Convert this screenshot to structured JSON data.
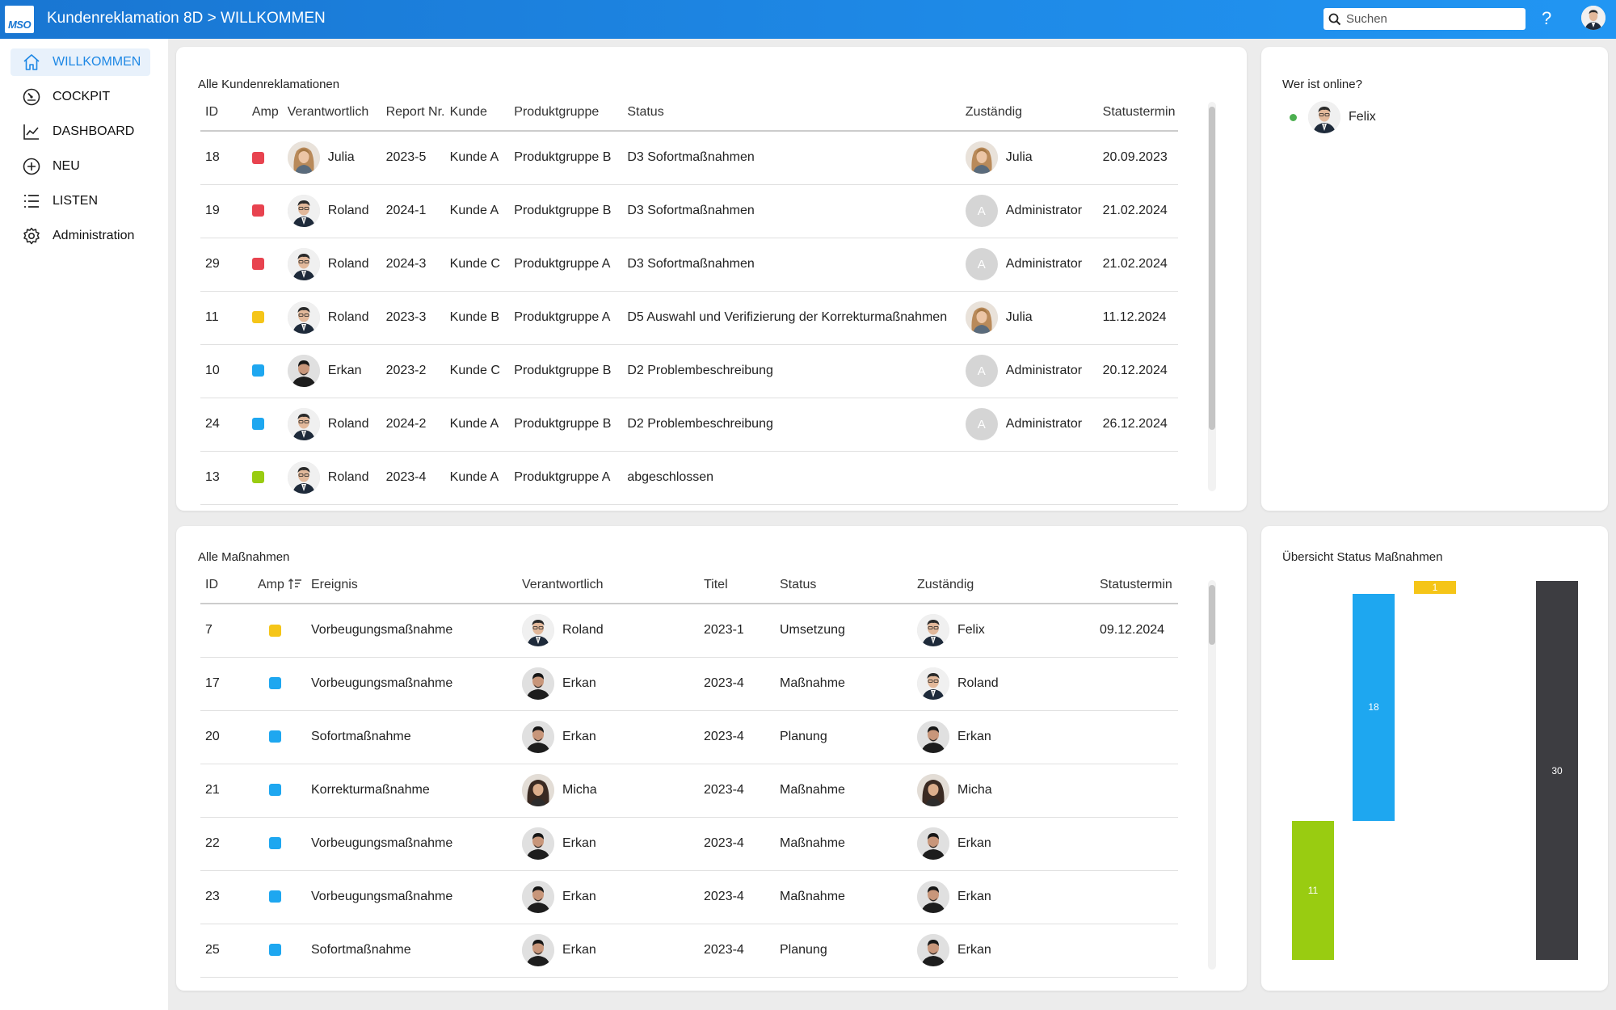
{
  "app": {
    "logo_text": "MSO",
    "title": "Kundenreklamation 8D > WILLKOMMEN",
    "search_placeholder": "Suchen",
    "help": "?"
  },
  "sidebar": {
    "items": [
      {
        "label": "WILLKOMMEN",
        "icon": "home-icon",
        "active": true
      },
      {
        "label": "COCKPIT",
        "icon": "gauge-icon"
      },
      {
        "label": "DASHBOARD",
        "icon": "line-chart-icon"
      },
      {
        "label": "NEU",
        "icon": "plus-circle-icon"
      },
      {
        "label": "LISTEN",
        "icon": "list-icon"
      },
      {
        "label": "Administration",
        "icon": "gear-icon"
      }
    ]
  },
  "complaints": {
    "title": "Alle Kundenreklamationen",
    "headers": [
      "ID",
      "Amp",
      "Verantwortlich",
      "Report Nr.",
      "Kunde",
      "Produktgruppe",
      "Status",
      "Zuständig",
      "Statustermin"
    ],
    "rows": [
      {
        "id": "18",
        "amp": "#e8434f",
        "resp": "Julia",
        "resp_avatar": "woman",
        "report": "2023-5",
        "kunde": "Kunde A",
        "gruppe": "Produktgruppe B",
        "status": "D3 Sofortmaßnahmen",
        "zust": "Julia",
        "zust_avatar": "woman",
        "termin": "20.09.2023"
      },
      {
        "id": "19",
        "amp": "#e8434f",
        "resp": "Roland",
        "resp_avatar": "man-suit",
        "report": "2024-1",
        "kunde": "Kunde A",
        "gruppe": "Produktgruppe B",
        "status": "D3 Sofortmaßnahmen",
        "zust": "Administrator",
        "zust_avatar": "admin",
        "termin": "21.02.2024"
      },
      {
        "id": "29",
        "amp": "#e8434f",
        "resp": "Roland",
        "resp_avatar": "man-suit",
        "report": "2024-3",
        "kunde": "Kunde C",
        "gruppe": "Produktgruppe A",
        "status": "D3 Sofortmaßnahmen",
        "zust": "Administrator",
        "zust_avatar": "admin",
        "termin": "21.02.2024"
      },
      {
        "id": "11",
        "amp": "#f5c518",
        "resp": "Roland",
        "resp_avatar": "man-suit",
        "report": "2023-3",
        "kunde": "Kunde B",
        "gruppe": "Produktgruppe A",
        "status": "D5 Auswahl und Verifizierung der Korrekturmaßnahmen",
        "zust": "Julia",
        "zust_avatar": "woman",
        "termin": "11.12.2024"
      },
      {
        "id": "10",
        "amp": "#1ea7f0",
        "resp": "Erkan",
        "resp_avatar": "man-dark",
        "report": "2023-2",
        "kunde": "Kunde C",
        "gruppe": "Produktgruppe B",
        "status": "D2 Problembeschreibung",
        "zust": "Administrator",
        "zust_avatar": "admin",
        "termin": "20.12.2024"
      },
      {
        "id": "24",
        "amp": "#1ea7f0",
        "resp": "Roland",
        "resp_avatar": "man-suit",
        "report": "2024-2",
        "kunde": "Kunde A",
        "gruppe": "Produktgruppe B",
        "status": "D2 Problembeschreibung",
        "zust": "Administrator",
        "zust_avatar": "admin",
        "termin": "26.12.2024"
      },
      {
        "id": "13",
        "amp": "#99cc11",
        "resp": "Roland",
        "resp_avatar": "man-suit",
        "report": "2023-4",
        "kunde": "Kunde A",
        "gruppe": "Produktgruppe A",
        "status": "abgeschlossen",
        "zust": "",
        "zust_avatar": "",
        "termin": ""
      }
    ]
  },
  "online": {
    "title": "Wer ist online?",
    "users": [
      {
        "name": "Felix",
        "avatar": "man-suit"
      }
    ],
    "admin_initial": "A"
  },
  "measures": {
    "title": "Alle Maßnahmen",
    "headers": [
      "ID",
      "Amp",
      "Ereignis",
      "Verantwortlich",
      "Titel",
      "Status",
      "Zuständig",
      "Statustermin"
    ],
    "sort_icon": "sort-desc-icon",
    "rows": [
      {
        "id": "7",
        "amp": "#f5c518",
        "event": "Vorbeugungsmaßnahme",
        "resp": "Roland",
        "resp_avatar": "man-suit",
        "titel": "2023-1",
        "status": "Umsetzung",
        "zust": "Felix",
        "zust_avatar": "man-suit",
        "termin": "09.12.2024"
      },
      {
        "id": "17",
        "amp": "#1ea7f0",
        "event": "Vorbeugungsmaßnahme",
        "resp": "Erkan",
        "resp_avatar": "man-dark",
        "titel": "2023-4",
        "status": "Maßnahme",
        "zust": "Roland",
        "zust_avatar": "man-suit",
        "termin": ""
      },
      {
        "id": "20",
        "amp": "#1ea7f0",
        "event": "Sofortmaßnahme",
        "resp": "Erkan",
        "resp_avatar": "man-dark",
        "titel": "2023-4",
        "status": "Planung",
        "zust": "Erkan",
        "zust_avatar": "man-dark",
        "termin": ""
      },
      {
        "id": "21",
        "amp": "#1ea7f0",
        "event": "Korrekturmaßnahme",
        "resp": "Micha",
        "resp_avatar": "woman-dark",
        "titel": "2023-4",
        "status": "Maßnahme",
        "zust": "Micha",
        "zust_avatar": "woman-dark",
        "termin": ""
      },
      {
        "id": "22",
        "amp": "#1ea7f0",
        "event": "Vorbeugungsmaßnahme",
        "resp": "Erkan",
        "resp_avatar": "man-dark",
        "titel": "2023-4",
        "status": "Maßnahme",
        "zust": "Erkan",
        "zust_avatar": "man-dark",
        "termin": ""
      },
      {
        "id": "23",
        "amp": "#1ea7f0",
        "event": "Vorbeugungsmaßnahme",
        "resp": "Erkan",
        "resp_avatar": "man-dark",
        "titel": "2023-4",
        "status": "Maßnahme",
        "zust": "Erkan",
        "zust_avatar": "man-dark",
        "termin": ""
      },
      {
        "id": "25",
        "amp": "#1ea7f0",
        "event": "Sofortmaßnahme",
        "resp": "Erkan",
        "resp_avatar": "man-dark",
        "titel": "2023-4",
        "status": "Planung",
        "zust": "Erkan",
        "zust_avatar": "man-dark",
        "termin": ""
      }
    ]
  },
  "status_chart": {
    "title": "Übersicht Status Maßnahmen"
  },
  "chart_data": {
    "type": "bar",
    "subtype": "floating-stacked",
    "title": "Übersicht Status Maßnahmen",
    "categories": [
      "",
      "",
      "",
      ""
    ],
    "bars": [
      {
        "value": 11,
        "start": 0,
        "color": "#99cc11"
      },
      {
        "value": 18,
        "start": 11,
        "color": "#1ea7f0"
      },
      {
        "value": 1,
        "start": 29,
        "color": "#f5c518"
      },
      {
        "value": 30,
        "start": 0,
        "color": "#3d3d41"
      }
    ],
    "ylim": [
      0,
      30
    ],
    "grid": false,
    "legend": "none"
  }
}
